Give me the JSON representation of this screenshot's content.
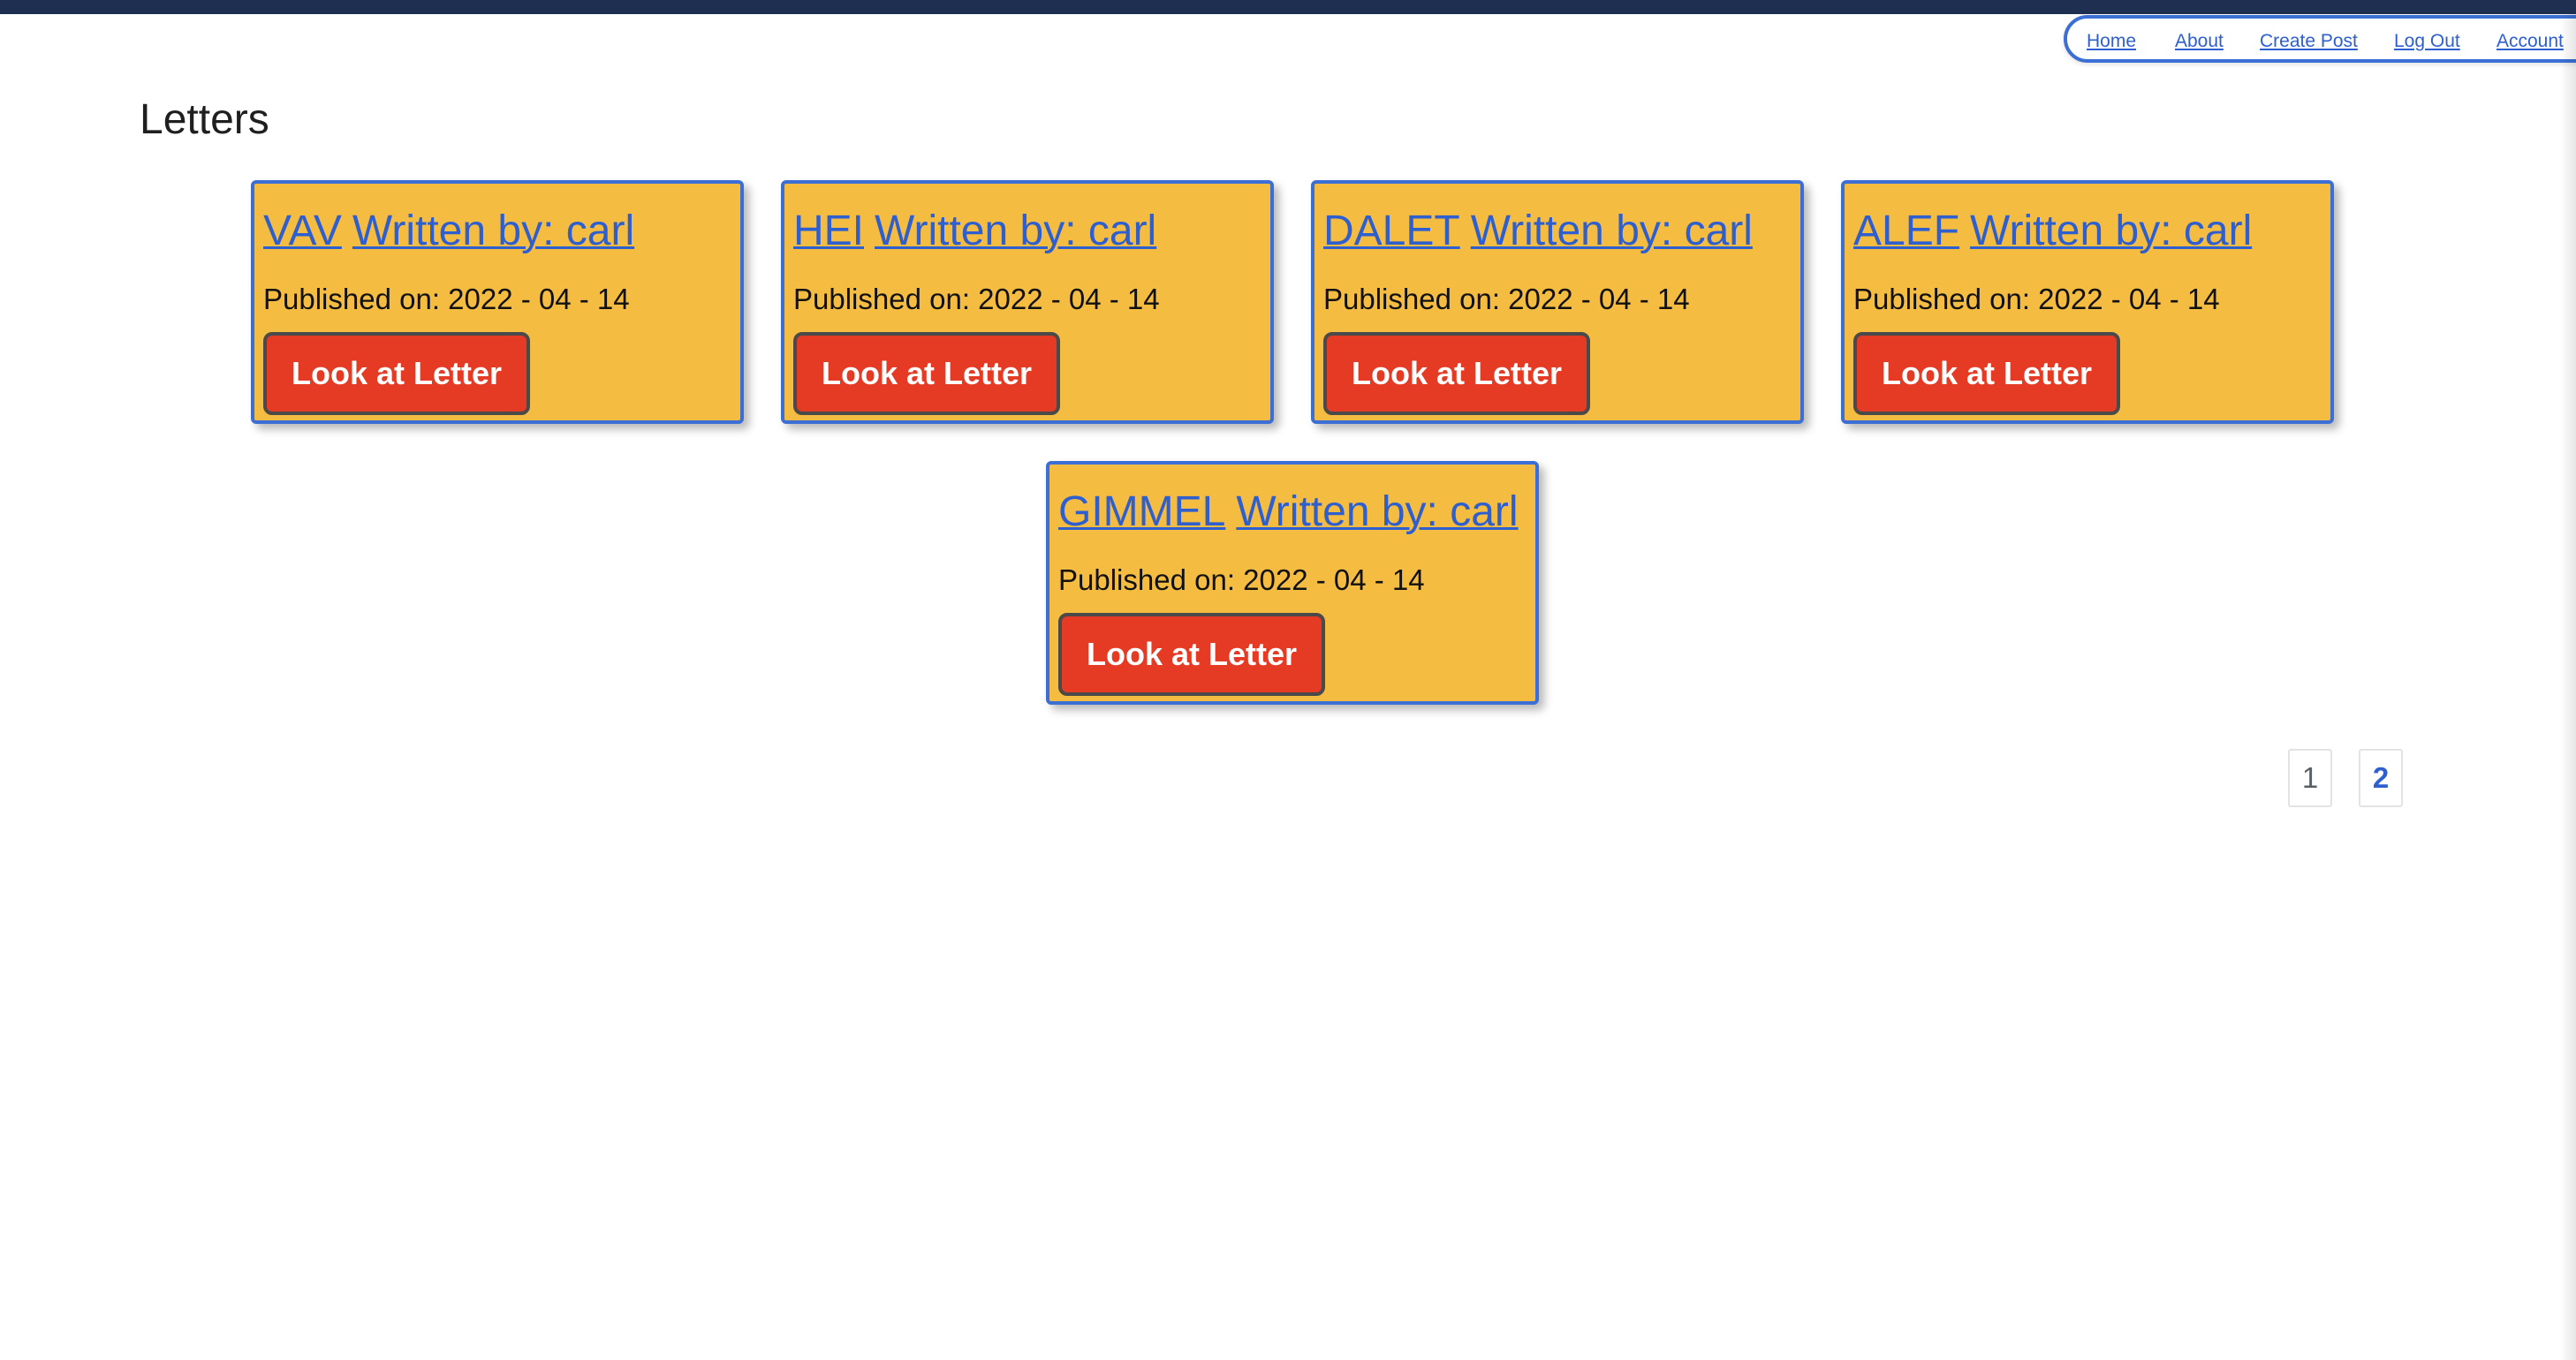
{
  "nav": {
    "home": "Home",
    "about": "About",
    "create_post": "Create Post",
    "log_out": "Log Out",
    "account": "Account"
  },
  "page": {
    "title": "Letters"
  },
  "letters": [
    {
      "name": "VAV",
      "author_label": "Written by: carl",
      "published": "Published on: 2022 - 04 - 14",
      "button": "Look at Letter"
    },
    {
      "name": "HEI",
      "author_label": "Written by: carl",
      "published": "Published on: 2022 - 04 - 14",
      "button": "Look at Letter"
    },
    {
      "name": "DALET",
      "author_label": "Written by: carl",
      "published": "Published on: 2022 - 04 - 14",
      "button": "Look at Letter"
    },
    {
      "name": "ALEF",
      "author_label": "Written by: carl",
      "published": "Published on: 2022 - 04 - 14",
      "button": "Look at Letter"
    },
    {
      "name": "GIMMEL",
      "author_label": "Written by: carl",
      "published": "Published on: 2022 - 04 - 14",
      "button": "Look at Letter"
    }
  ],
  "pagination": {
    "pages": [
      "1",
      "2"
    ],
    "current": "1"
  },
  "colors": {
    "topbar": "#1f2f52",
    "link": "#2d5fd0",
    "card_bg": "#f5bc42",
    "card_border": "#3b6fd6",
    "button_bg": "#e53a24",
    "pager_inactive": "#5a5f66"
  }
}
